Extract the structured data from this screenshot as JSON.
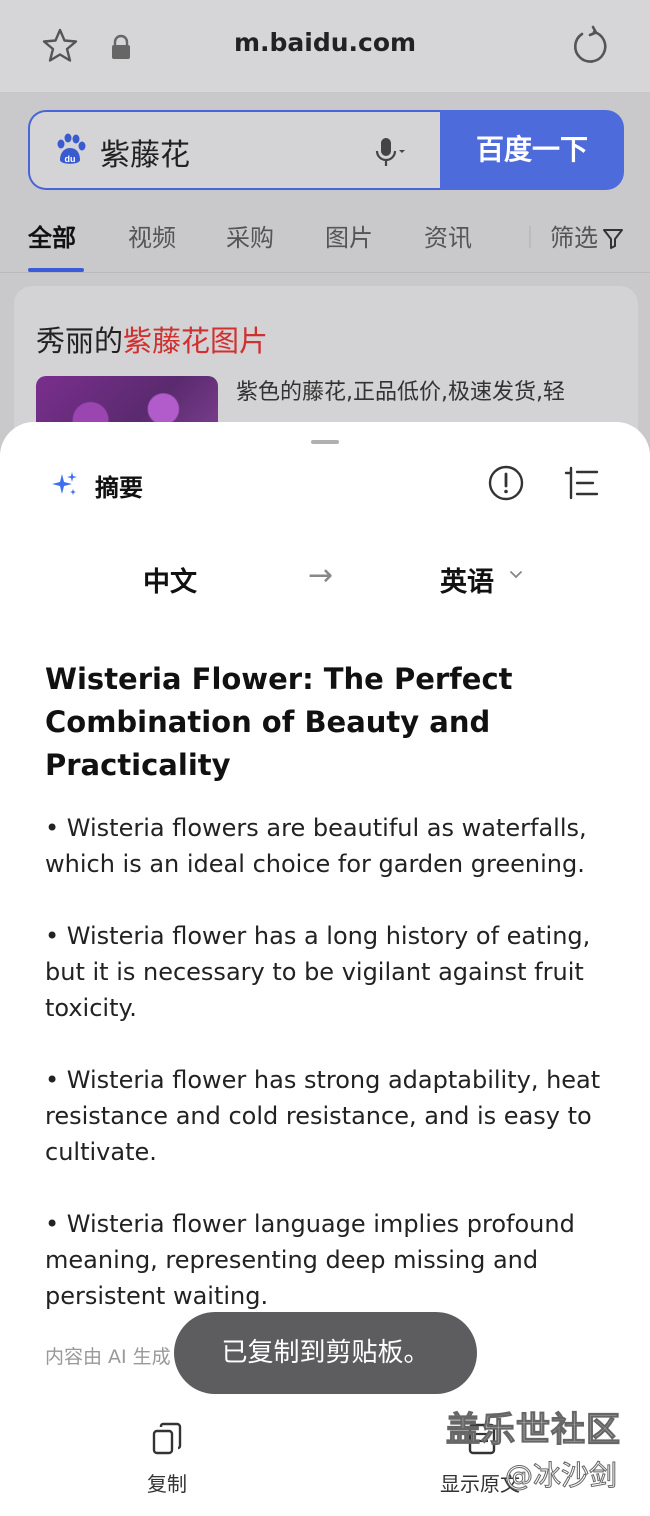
{
  "browser": {
    "url": "m.baidu.com"
  },
  "search": {
    "query": "紫藤花",
    "button_label": "百度一下",
    "tabs": [
      {
        "label": "全部"
      },
      {
        "label": "视频"
      },
      {
        "label": "采购"
      },
      {
        "label": "图片"
      },
      {
        "label": "资讯"
      }
    ],
    "filter_label": "筛选"
  },
  "result": {
    "title_prefix": "秀丽的",
    "title_highlight": "紫藤花图片",
    "description": "紫色的藤花,正品低价,极速发货,轻"
  },
  "summary_panel": {
    "label": "摘要",
    "source_lang": "中文",
    "arrow": "→",
    "target_lang": "英语",
    "title": "Wisteria Flower: The Perfect Combination of Beauty and Practicality",
    "bullets": [
      "• Wisteria flowers are beautiful as waterfalls, which is an ideal choice for garden greening.",
      "• Wisteria flower has a long history of eating, but it is necessary to be vigilant against fruit toxicity.",
      "• Wisteria flower has strong adaptability, heat resistance and cold resistance, and is easy to cultivate.",
      "• Wisteria flower language implies profound meaning, representing deep missing and persistent waiting."
    ],
    "ai_note": "内容由 AI 生成",
    "toast": "已复制到剪贴板。",
    "copy_label": "复制",
    "show_original_label": "显示原文"
  },
  "watermark": {
    "line1": "盖乐世社区",
    "line2": "@冰沙剑"
  },
  "colors": {
    "accent": "#4e6bdc",
    "highlight": "#d03030",
    "toast_bg": "#5d5d5f"
  }
}
